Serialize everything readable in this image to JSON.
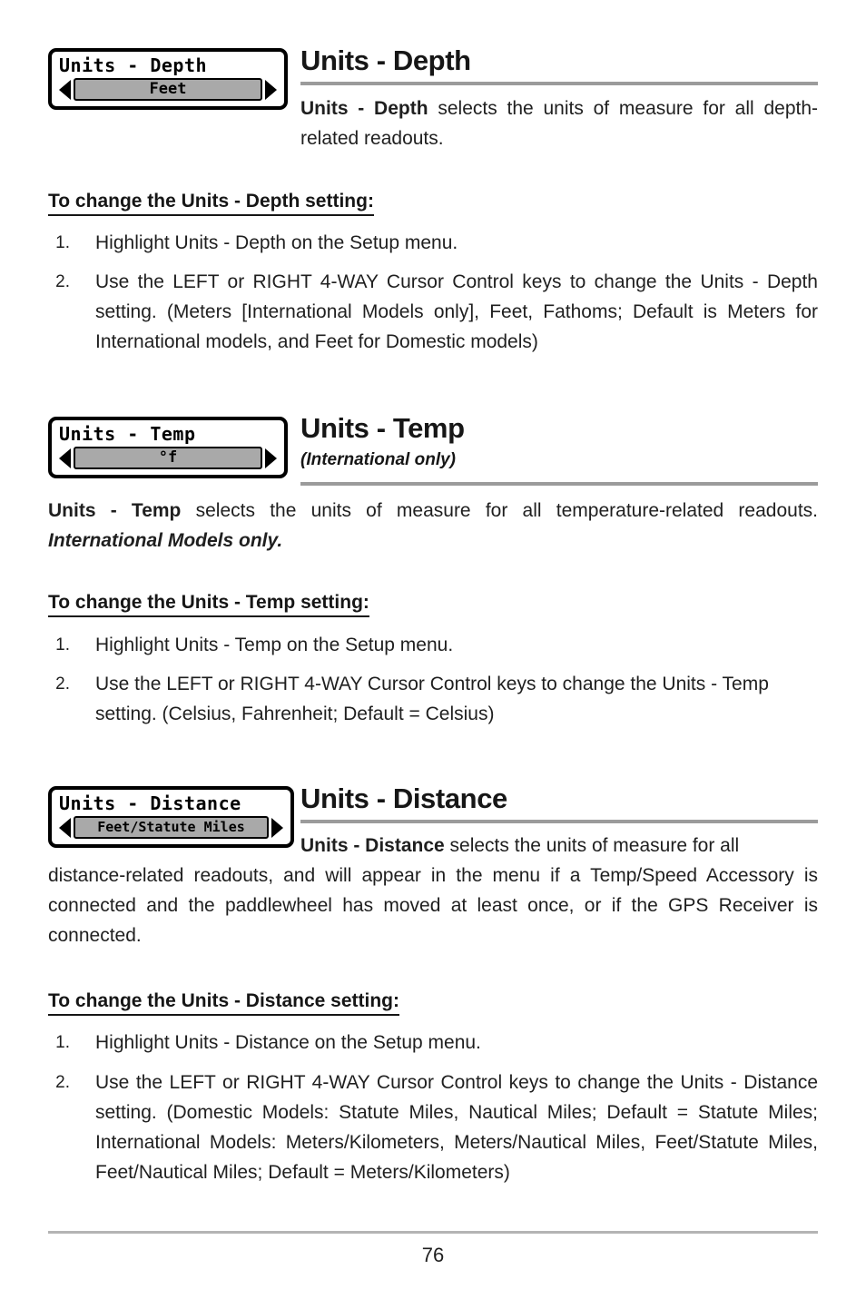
{
  "page": {
    "number": "76",
    "document_type": "manual-page"
  },
  "sections": [
    {
      "id": "units-depth",
      "heading": "Units - Depth",
      "subtitle": "",
      "lcd": {
        "title": "Units - Depth",
        "value": "Feet",
        "left_arrow": "left-arrow-icon",
        "right_arrow": "right-arrow-icon"
      },
      "intro": {
        "bold_lead": "Units - Depth",
        "rest": " selects the units of measure for all depth-related readouts."
      },
      "instruction_heading": "To change the Units - Depth setting:",
      "steps": [
        {
          "num": "1.",
          "text": "Highlight Units - Depth on the Setup menu."
        },
        {
          "num": "2.",
          "pre": "Use the LEFT or RIGHT 4-WAY Cursor Control keys to change the Units - Depth setting. (Meters ",
          "emphasis": "[International Models only]",
          "post": ", Feet, Fathoms; Default is Meters for International models, and Feet for Domestic models)"
        }
      ]
    },
    {
      "id": "units-temp",
      "heading": "Units - Temp",
      "subtitle": "(International only)",
      "lcd": {
        "title": "Units - Temp",
        "value": "°f",
        "left_arrow": "left-arrow-icon",
        "right_arrow": "right-arrow-icon"
      },
      "intro": {
        "bold_lead": "Units - Temp",
        "rest": " selects the units of measure for all temperature-related readouts. ",
        "italic_tail": "International Models only."
      },
      "instruction_heading": "To change the Units - Temp setting:",
      "steps": [
        {
          "num": "1.",
          "text": "Highlight Units - Temp on the Setup menu."
        },
        {
          "num": "2.",
          "text": "Use the LEFT or RIGHT 4-WAY Cursor Control keys to change the Units - Temp setting. (Celsius, Fahrenheit; Default = Celsius)"
        }
      ]
    },
    {
      "id": "units-distance",
      "heading": "Units - Distance",
      "subtitle": "",
      "lcd": {
        "title": "Units - Distance",
        "value": "Feet/Statute Miles",
        "left_arrow": "left-arrow-icon",
        "right_arrow": "right-arrow-icon"
      },
      "intro": {
        "bold_lead": "Units - Distance",
        "rest": " selects the units of measure for all distance-related readouts, and will appear in the menu if a Temp/Speed Accessory is connected and the paddlewheel has moved at least once, or if the GPS Receiver is connected."
      },
      "instruction_heading": "To change the Units - Distance setting:",
      "steps": [
        {
          "num": "1.",
          "text": "Highlight Units - Distance on the Setup menu."
        },
        {
          "num": "2.",
          "text": "Use the LEFT or RIGHT 4-WAY Cursor Control keys to change the Units - Distance setting. (Domestic Models: Statute Miles, Nautical Miles; Default = Statute Miles; International Models: Meters/Kilometers, Meters/Nautical Miles, Feet/Statute Miles, Feet/Nautical Miles; Default = Meters/Kilometers)"
        }
      ]
    }
  ],
  "colors": {
    "rule_gray": "#9b9b9b",
    "lcd_fill_gray": "#a9a9a9",
    "text": "#1f1f1f",
    "border_black": "#000000"
  }
}
